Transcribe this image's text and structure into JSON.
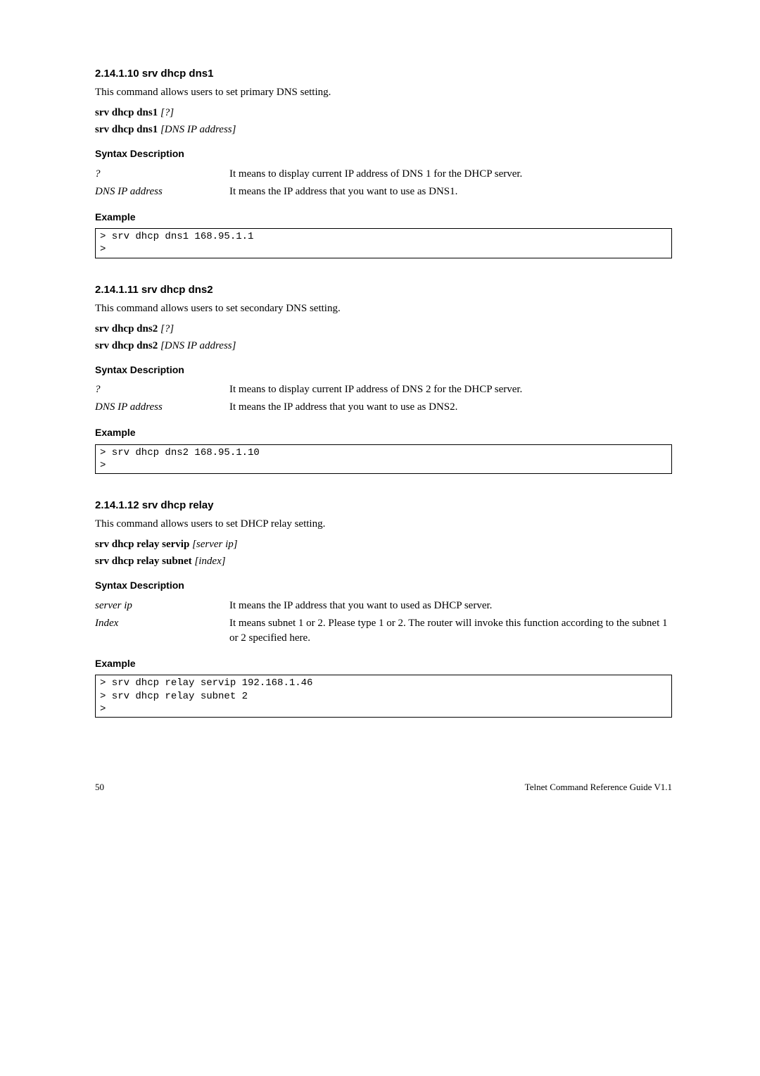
{
  "s1": {
    "heading": "2.14.1.10 srv dhcp dns1",
    "intro": "This command allows users to set primary DNS setting.",
    "syntax_lines": [
      {
        "cmd": "srv dhcp dns1",
        "arg": "[?]"
      },
      {
        "cmd": "srv dhcp dns1",
        "arg": "[DNS IP address]"
      }
    ],
    "syntax_hdr": "Syntax Description",
    "rows": [
      {
        "k": "?",
        "v": "It means to display current IP address of DNS 1 for the DHCP server."
      },
      {
        "k": "DNS IP address",
        "v": "It means the IP address that you want to use as DNS1."
      }
    ],
    "example_hdr": "Example",
    "example": "> srv dhcp dns1 168.95.1.1\n>"
  },
  "s2": {
    "heading": "2.14.1.11 srv dhcp dns2",
    "intro": "This command allows users to set secondary DNS setting.",
    "syntax_lines": [
      {
        "cmd": "srv dhcp dns2",
        "arg": "[?]"
      },
      {
        "cmd": "srv dhcp dns2",
        "arg": "[DNS IP address]"
      }
    ],
    "syntax_hdr": "Syntax Description",
    "rows": [
      {
        "k": "?",
        "v": "It means to display current IP address of DNS 2 for the DHCP server."
      },
      {
        "k": "DNS IP address",
        "v": "It means the IP address that you want to use as DNS2."
      }
    ],
    "example_hdr": "Example",
    "example": "> srv dhcp dns2 168.95.1.10\n>"
  },
  "s3": {
    "heading": "2.14.1.12 srv dhcp relay",
    "intro": "This command allows users to set DHCP relay setting.",
    "syntax_lines": [
      {
        "cmd": "srv dhcp relay servip",
        "arg": "[server ip]"
      },
      {
        "cmd": "srv dhcp relay subnet",
        "arg": "[index]"
      }
    ],
    "syntax_hdr": "Syntax Description",
    "rows": [
      {
        "k": "server ip",
        "v": "It means the IP address that you want to used as DHCP server."
      },
      {
        "k": "Index",
        "v": "It means subnet 1 or 2. Please type 1 or 2. The router will invoke this function according to the subnet 1 or 2 specified here."
      }
    ],
    "example_hdr": "Example",
    "example": "> srv dhcp relay servip 192.168.1.46\n> srv dhcp relay subnet 2\n>"
  },
  "footer": {
    "page": "50",
    "title": "Telnet Command Reference Guide V1.1"
  }
}
